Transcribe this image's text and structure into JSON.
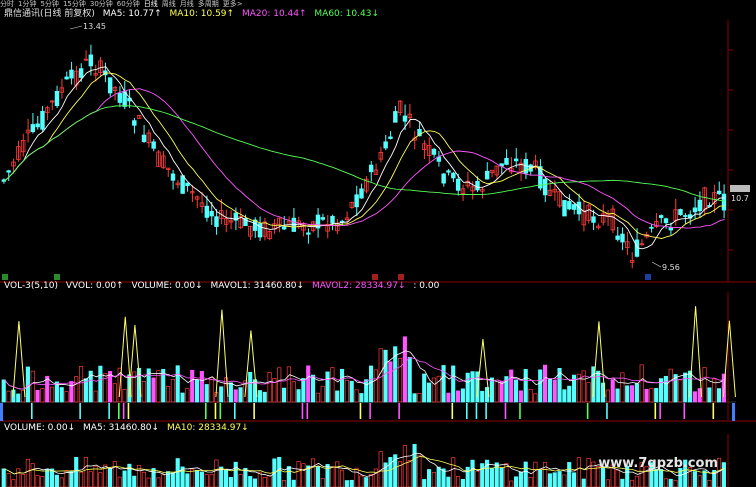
{
  "toolbar": {
    "periods": [
      "分时",
      "1分钟",
      "5分钟",
      "15分钟",
      "30分钟",
      "60分钟",
      "日线",
      "周线",
      "月线",
      "多周期",
      "更多>"
    ],
    "active_index": 6
  },
  "price_header": {
    "stock": "鼎信通讯(日线 前复权)",
    "ma5": "MA5: 10.77↑",
    "ma10": "MA10: 10.59↑",
    "ma20": "MA20: 10.44↑",
    "ma60": "MA60: 10.43↓"
  },
  "vol_header": {
    "label": "VOL-3(5,10)",
    "vvol": "VVOL: 0.00↑",
    "volume": "VOLUME: 0.00↓",
    "mavol1": "MAVOL1: 31460.80↓",
    "mavol2": "MAVOL2: 28334.97↓",
    "extra": ": 0.00"
  },
  "vol2_header": {
    "volume": "VOLUME: 0.00↓",
    "ma5": "MA5: 31460.80↓",
    "ma10": "MA10: 28334.97↓"
  },
  "annotations": {
    "high": "13.45",
    "low": "9.56",
    "last": "10.7"
  },
  "watermark": "www.7gpzb.com",
  "colors": {
    "up": "#ff3b3b",
    "down": "#54ffff",
    "ma5": "#ffffff",
    "ma10": "#ffff55",
    "ma20": "#ff55ff",
    "ma60": "#55ff55"
  }
}
